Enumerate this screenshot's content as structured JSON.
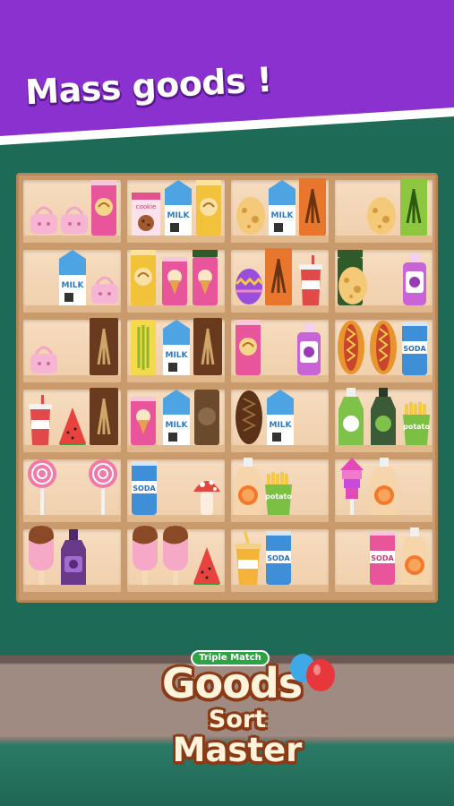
{
  "banner": {
    "text": "Mass goods !"
  },
  "logo": {
    "tag": "Triple Match",
    "line1": "Goods",
    "line2": "Sort",
    "line3": "Master"
  },
  "shelf": {
    "rows": 6,
    "columns": 4,
    "cells": [
      [
        "purse purse chips-can",
        "cookie-box milk chips-can",
        "egg milk pocky-box",
        "egg pocky-box"
      ],
      [
        "milk purse",
        "chips-can icecream-can icecream-can",
        "easter-egg pocky-box cup",
        "chips-can egg jam-jar"
      ],
      [
        "purse choco-box",
        "energy-can milk choco-box",
        "chips-can jam-jar",
        "hotdog hotdog soda-can"
      ],
      [
        "cup watermelon choco-box",
        "icecream-can milk chips-can",
        "choco-bar milk",
        "juice-bottle juice-bottle fries"
      ],
      [
        "lollipop lollipop",
        "soda-can mushroom",
        "orange-juice fries",
        "rocket-pop orange-juice"
      ],
      [
        "popsicle jam-bottle",
        "popsicle popsicle watermelon",
        "juice-cup soda-can",
        "soda-can orange-juice"
      ]
    ],
    "labels": {
      "milk": "MILK",
      "soda": "SODA",
      "potato": "potato",
      "cookie": "cookie"
    }
  },
  "colors": {
    "banner": "#8a2fd0",
    "wall": "#1d6a57",
    "shelf": "#c89a6c",
    "logo_text": "#fff3dc"
  }
}
